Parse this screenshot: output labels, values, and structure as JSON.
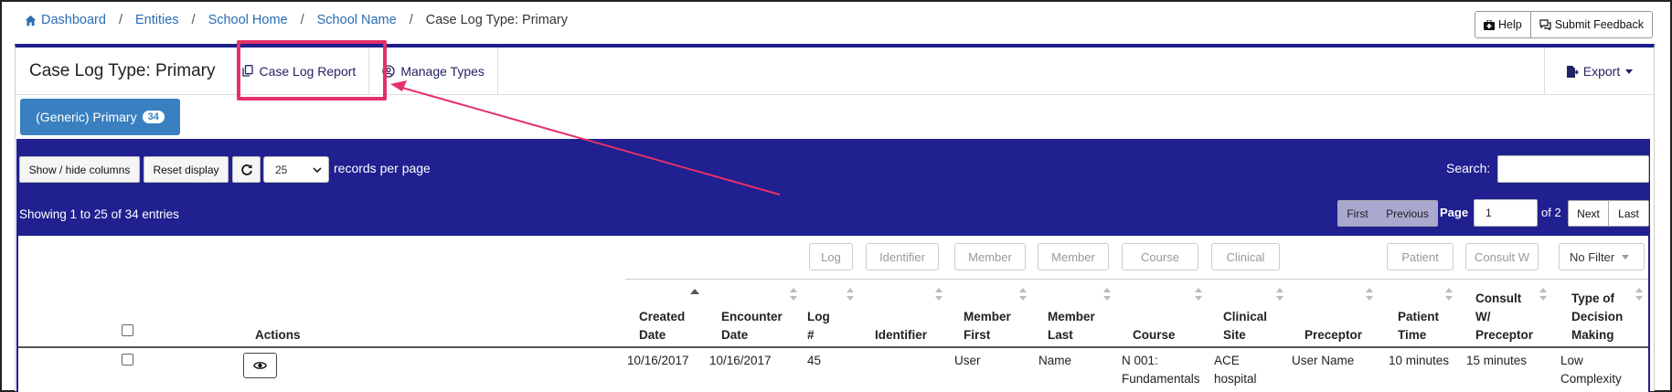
{
  "breadcrumb": {
    "items": [
      "Dashboard",
      "Entities",
      "School Home",
      "School Name"
    ],
    "current": "Case Log Type: Primary",
    "separator": "/"
  },
  "top_buttons": {
    "help": "Help",
    "feedback": "Submit Feedback"
  },
  "panel": {
    "title": "Case Log Type: Primary",
    "report_link": "Case Log Report",
    "manage_link": "Manage Types",
    "export": "Export"
  },
  "type_button": {
    "label": "(Generic) Primary",
    "count": "34"
  },
  "toolbar": {
    "show_hide": "Show / hide columns",
    "reset": "Reset display",
    "records_value": "25",
    "records_label": "records per page",
    "search_label": "Search:",
    "search_value": ""
  },
  "info": "Showing 1 to 25 of 34 entries",
  "pager": {
    "first": "First",
    "previous": "Previous",
    "page_label": "Page",
    "page_value": "1",
    "of_label": "of 2",
    "next": "Next",
    "last": "Last"
  },
  "filters": {
    "log": "Log",
    "identifier": "Identifier",
    "member_first": "Member",
    "member_last": "Member",
    "course": "Course",
    "clinical": "Clinical",
    "patient": "Patient",
    "consult": "Consult W",
    "no_filter": "No Filter"
  },
  "columns": {
    "actions": "Actions",
    "created_1": "Created",
    "created_2": "Date",
    "encounter_1": "Encounter",
    "encounter_2": "Date",
    "log_1": "Log",
    "log_2": "#",
    "identifier": "Identifier",
    "mfirst_1": "Member",
    "mfirst_2": "First",
    "mlast_1": "Member",
    "mlast_2": "Last",
    "course": "Course",
    "clinical_1": "Clinical",
    "clinical_2": "Site",
    "preceptor": "Preceptor",
    "ptime_1": "Patient",
    "ptime_2": "Time",
    "consult_1": "Consult",
    "consult_2": "W/",
    "consult_3": "Preceptor",
    "decision_1": "Type of",
    "decision_2": "Decision",
    "decision_3": "Making"
  },
  "row": {
    "created": "10/16/2017",
    "encounter": "10/16/2017",
    "log": "45",
    "identifier": "",
    "member_first": "User",
    "member_last": "Name",
    "course_1": "N 001:",
    "course_2": "Fundamentals",
    "clinical_1": "ACE",
    "clinical_2": "hospital",
    "preceptor": "User Name",
    "patient_time": "10 minutes",
    "consult": "15 minutes",
    "decision_1": "Low",
    "decision_2": "Complexity"
  },
  "colors": {
    "accent_navy": "#202090",
    "link_blue": "#2a6db5",
    "button_blue": "#3a80c0",
    "highlight_pink": "#e5306a"
  }
}
